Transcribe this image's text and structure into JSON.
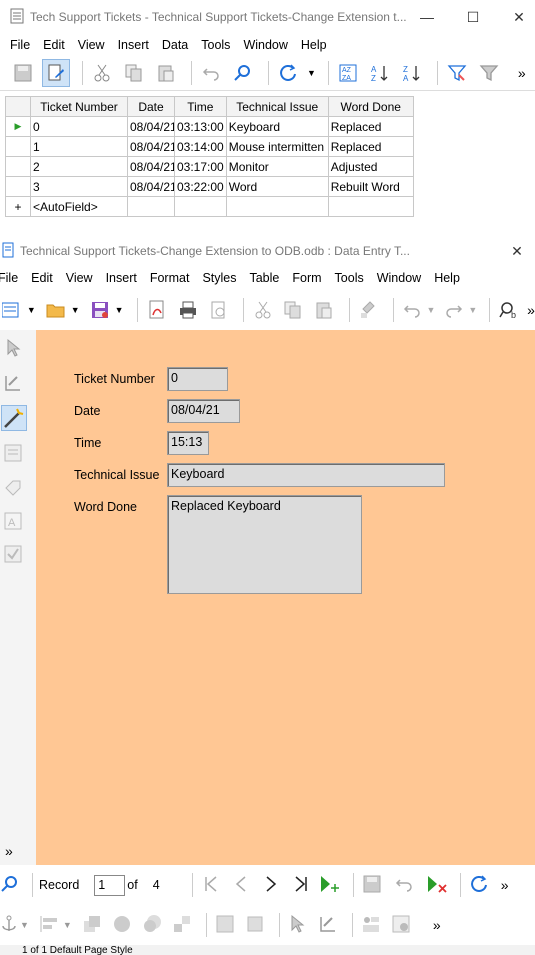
{
  "win1": {
    "title": "Tech Support Tickets - Technical Support Tickets-Change Extension t...",
    "menu": [
      "File",
      "Edit",
      "View",
      "Insert",
      "Data",
      "Tools",
      "Window",
      "Help"
    ],
    "table": {
      "headers": [
        "Ticket Number",
        "Date",
        "Time",
        "Technical Issue",
        "Word Done"
      ],
      "rows": [
        [
          "0",
          "08/04/21",
          "03:13:00",
          "Keyboard",
          "Replaced"
        ],
        [
          "1",
          "08/04/21",
          "03:14:00",
          "Mouse intermitten",
          "Replaced"
        ],
        [
          "2",
          "08/04/21",
          "03:17:00",
          "Monitor",
          "Adjusted"
        ],
        [
          "3",
          "08/04/21",
          "03:22:00",
          "Word",
          "Rebuilt Word"
        ]
      ],
      "new_row": "<AutoField>"
    }
  },
  "win2": {
    "title": "Technical Support Tickets-Change Extension to ODB.odb : Data Entry T...",
    "menu": [
      "File",
      "Edit",
      "View",
      "Insert",
      "Format",
      "Styles",
      "Table",
      "Form",
      "Tools",
      "Window",
      "Help"
    ],
    "form": {
      "ticket_number_label": "Ticket Number",
      "ticket_number_value": "0",
      "date_label": "Date",
      "date_value": "08/04/21",
      "time_label": "Time",
      "time_value": "15:13",
      "issue_label": "Technical Issue",
      "issue_value": "Keyboard",
      "work_label": "Word Done",
      "work_value": "Replaced Keyboard"
    },
    "nav": {
      "record_label": "Record",
      "record_value": "1",
      "of_label": "of",
      "total": "4"
    },
    "status": "1 of 1     Default Page Style"
  },
  "colors": {
    "form_bg": "#ffc794",
    "accent": "#1e6fd9"
  }
}
